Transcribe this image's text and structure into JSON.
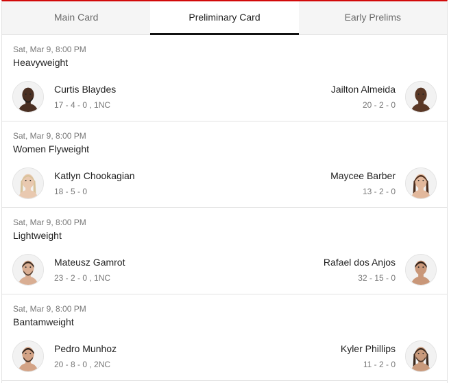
{
  "tabs": [
    {
      "label": "Main Card",
      "active": false
    },
    {
      "label": "Preliminary Card",
      "active": true
    },
    {
      "label": "Early Prelims",
      "active": false
    }
  ],
  "colors": {
    "accent": "#d20a0a",
    "active_underline": "#111111"
  },
  "fights": [
    {
      "date": "Sat, Mar 9, 8:00 PM",
      "weight_class": "Heavyweight",
      "red": {
        "name": "Curtis Blaydes",
        "record": "17 - 4 - 0 , 1NC",
        "skin": "#4a2f22",
        "hair": "#1a1a1a",
        "bald": true,
        "beard": true
      },
      "blue": {
        "name": "Jailton Almeida",
        "record": "20 - 2 - 0",
        "skin": "#5a3826",
        "hair": "#151515",
        "bald": true,
        "beard": false
      }
    },
    {
      "date": "Sat, Mar 9, 8:00 PM",
      "weight_class": "Women Flyweight",
      "red": {
        "name": "Katlyn Chookagian",
        "record": "18 - 5 - 0",
        "skin": "#e9c9b0",
        "hair": "#d8c29a",
        "bald": false,
        "beard": false,
        "longhair": true
      },
      "blue": {
        "name": "Maycee Barber",
        "record": "13 - 2 - 0",
        "skin": "#e2b89c",
        "hair": "#4a2c1c",
        "bald": false,
        "beard": false,
        "longhair": true
      }
    },
    {
      "date": "Sat, Mar 9, 8:00 PM",
      "weight_class": "Lightweight",
      "red": {
        "name": "Mateusz Gamrot",
        "record": "23 - 2 - 0 , 1NC",
        "skin": "#d9ae93",
        "hair": "#3a2a20",
        "bald": false,
        "beard": true
      },
      "blue": {
        "name": "Rafael dos Anjos",
        "record": "32 - 15 - 0",
        "skin": "#c99779",
        "hair": "#2a1d16",
        "bald": false,
        "beard": false
      }
    },
    {
      "date": "Sat, Mar 9, 8:00 PM",
      "weight_class": "Bantamweight",
      "red": {
        "name": "Pedro Munhoz",
        "record": "20 - 8 - 0 , 2NC",
        "skin": "#d3a386",
        "hair": "#2b1e17",
        "bald": false,
        "beard": true
      },
      "blue": {
        "name": "Kyler Phillips",
        "record": "11 - 2 - 0",
        "skin": "#c99a7c",
        "hair": "#3a281d",
        "bald": false,
        "beard": true,
        "longhair": true
      }
    }
  ]
}
